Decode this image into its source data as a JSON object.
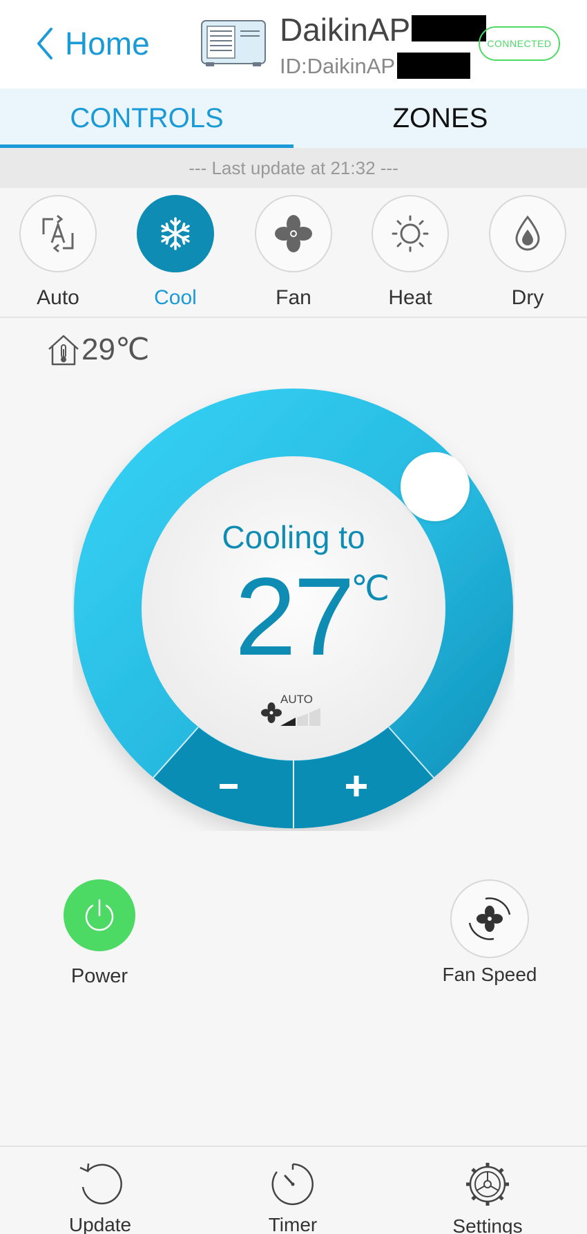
{
  "header": {
    "back_label": "Home",
    "device_name": "DaikinAP",
    "device_id": "ID:DaikinAP",
    "status_badge": "CONNECTED"
  },
  "tabs": [
    {
      "label": "CONTROLS",
      "active": true
    },
    {
      "label": "ZONES",
      "active": false
    }
  ],
  "last_update": "--- Last update at 21:32 ---",
  "modes": [
    {
      "label": "Auto",
      "icon": "auto-mode-icon",
      "active": false
    },
    {
      "label": "Cool",
      "icon": "snowflake-icon",
      "active": true
    },
    {
      "label": "Fan",
      "icon": "fan-icon",
      "active": false
    },
    {
      "label": "Heat",
      "icon": "sun-icon",
      "active": false
    },
    {
      "label": "Dry",
      "icon": "droplet-icon",
      "active": false
    }
  ],
  "indoor_temp": "29℃",
  "dial": {
    "status": "Cooling to",
    "setpoint": "27",
    "unit": "℃",
    "fan_mode": "AUTO",
    "minus_label": "-",
    "plus_label": "+"
  },
  "controls": {
    "power_label": "Power",
    "fan_speed_label": "Fan Speed"
  },
  "nav": [
    {
      "label": "Update",
      "icon": "refresh-icon"
    },
    {
      "label": "Timer",
      "icon": "timer-icon"
    },
    {
      "label": "Settings",
      "icon": "gear-icon"
    }
  ],
  "colors": {
    "accent": "#1a9ad6",
    "dial_dark": "#0f8cb3",
    "dial_light": "#38d4f8",
    "power_green": "#4cd964"
  }
}
